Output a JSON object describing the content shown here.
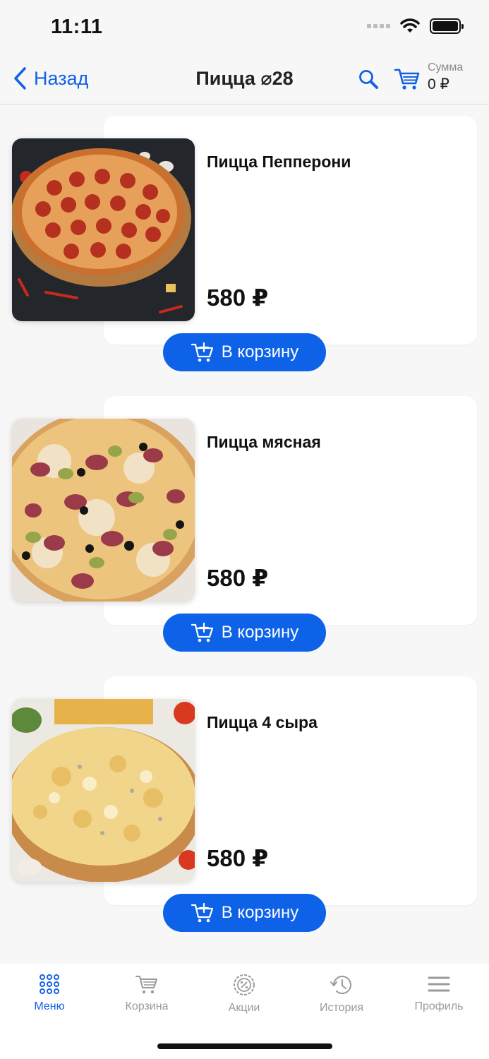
{
  "status_bar": {
    "time": "11:11"
  },
  "nav": {
    "back_label": "Назад",
    "title": "Пицца ⌀28",
    "sum_label": "Сумма",
    "sum_value": "0 ₽"
  },
  "products": [
    {
      "name": "Пицца Пепперони",
      "price": "580 ₽",
      "button": "В корзину",
      "photo": "pepperoni-pizza"
    },
    {
      "name": "Пицца мясная",
      "price": "580 ₽",
      "button": "В корзину",
      "photo": "meat-pizza"
    },
    {
      "name": "Пицца 4 сыра",
      "price": "580 ₽",
      "button": "В корзину",
      "photo": "four-cheese-pizza"
    }
  ],
  "tabs": [
    {
      "label": "Меню",
      "icon": "grid-icon",
      "active": true
    },
    {
      "label": "Корзина",
      "icon": "cart-icon",
      "active": false
    },
    {
      "label": "Акции",
      "icon": "discount-icon",
      "active": false
    },
    {
      "label": "История",
      "icon": "history-icon",
      "active": false
    },
    {
      "label": "Профиль",
      "icon": "menu-icon",
      "active": false
    }
  ],
  "colors": {
    "accent": "#0d62e8",
    "inactive": "#9a9a9a",
    "background": "#f7f7f7"
  }
}
